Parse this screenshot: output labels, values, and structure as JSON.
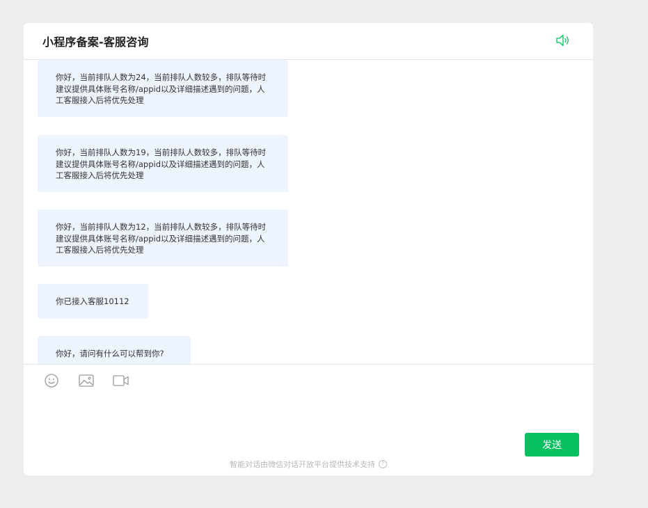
{
  "header": {
    "title": "小程序备案-客服咨询",
    "speaker_icon": "speaker-icon"
  },
  "messages": [
    {
      "text": "你好，当前排队人数为24，当前排队人数较多，排队等待时建议提供具体账号名称/appid以及详细描述遇到的问题，人工客服接入后将优先处理"
    },
    {
      "text": "你好，当前排队人数为19，当前排队人数较多，排队等待时建议提供具体账号名称/appid以及详细描述遇到的问题，人工客服接入后将优先处理"
    },
    {
      "text": "你好，当前排队人数为12，当前排队人数较多，排队等待时建议提供具体账号名称/appid以及详细描述遇到的问题，人工客服接入后将优先处理"
    },
    {
      "text": "你已接入客服10112"
    },
    {
      "text": "你好，请问有什么可以帮到你?"
    }
  ],
  "toolbar": {
    "emoji_icon": "emoji-icon",
    "image_icon": "image-icon",
    "video_icon": "video-icon"
  },
  "composer": {
    "value": "",
    "send_label": "发送"
  },
  "footer": {
    "text": "智能对话由微信对话开放平台提供技术支持",
    "help_glyph": "?"
  },
  "colors": {
    "accent": "#07c160",
    "bubble_bg": "#eef4fe",
    "page_bg": "#ededed"
  }
}
